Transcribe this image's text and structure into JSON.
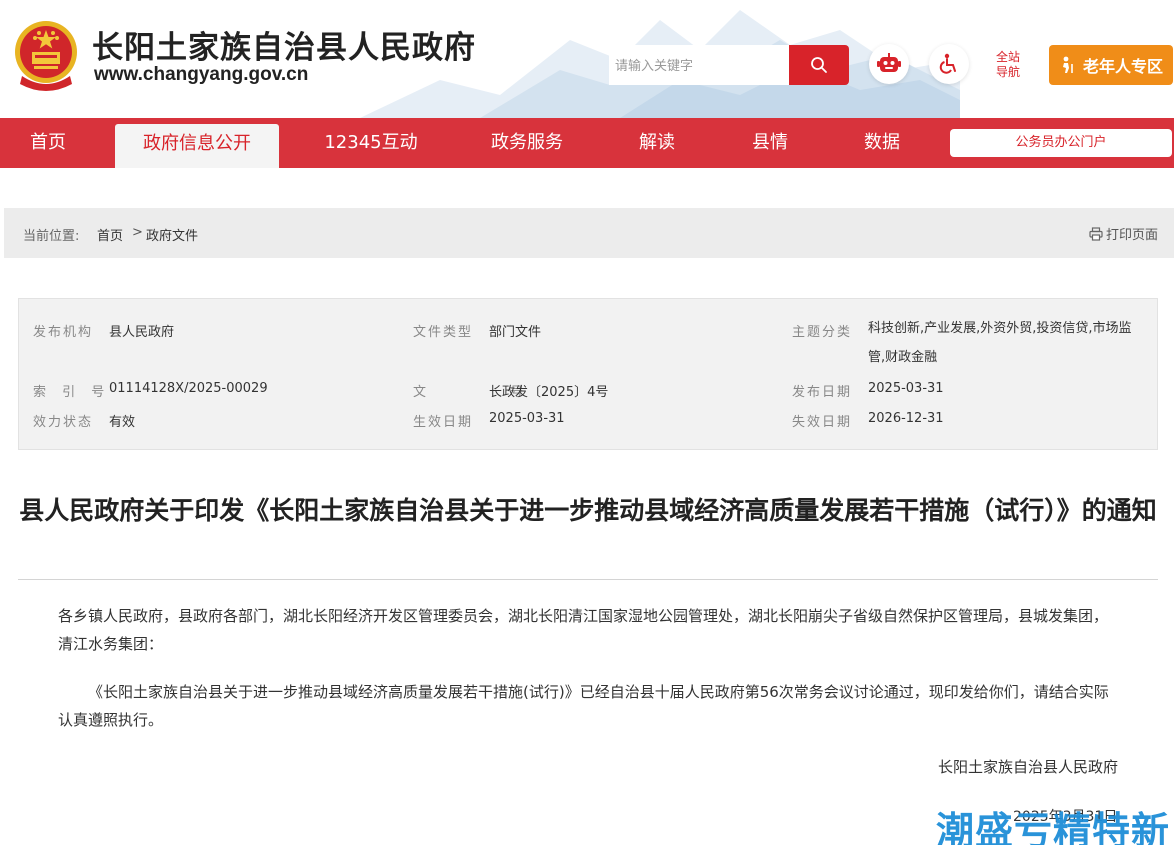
{
  "header": {
    "site_title": "长阳土家族自治县人民政府",
    "site_url": "www.changyang.gov.cn",
    "search_placeholder": "请输入关键字",
    "sitemap_line1": "全站",
    "sitemap_line2": "导航",
    "elder_label": "老年人专区",
    "colors": {
      "brand_red": "#d8232a",
      "elder_orange": "#f08d18"
    },
    "icons": [
      "national-emblem-icon",
      "search-icon",
      "robot-icon",
      "accessibility-icon",
      "elder-icon"
    ]
  },
  "nav": {
    "items": [
      {
        "label": "首页"
      },
      {
        "label": "政府信息公开"
      },
      {
        "label": "12345互动"
      },
      {
        "label": "政务服务"
      },
      {
        "label": "解读"
      },
      {
        "label": "县情"
      },
      {
        "label": "数据"
      }
    ],
    "active_index": 1,
    "portal_label": "公务员办公门户"
  },
  "breadcrumb": {
    "label": "当前位置:",
    "home": "首页",
    "separator": ">",
    "current": "政府文件",
    "print_label": "打印页面"
  },
  "meta": {
    "publisher_key": "发布机构",
    "publisher": "县人民政府",
    "doc_type_key": "文件类型",
    "doc_type": "部门文件",
    "topic_key": "主题分类",
    "topic": "科技创新,产业发展,外资外贸,投资信贷,市场监管,财政金融",
    "index_key": "索 引 号",
    "index": "01114128X/2025-00029",
    "doc_no_key": "文 号",
    "doc_no": "长政发〔2025〕4号",
    "pub_date_key": "发布日期",
    "pub_date": "2025-03-31",
    "status_key": "效力状态",
    "status": "有效",
    "effective_key": "生效日期",
    "effective": "2025-03-31",
    "expire_key": "失效日期",
    "expire": "2026-12-31"
  },
  "article": {
    "title": "县人民政府关于印发《长阳土家族自治县关于进一步推动县域经济高质量发展若干措施（试行）》的通知",
    "recipients": "各乡镇人民政府，县政府各部门，湖北长阳经济开发区管理委员会，湖北长阳清江国家湿地公园管理处，湖北长阳崩尖子省级自然保护区管理局，县城发集团，清江水务集团：",
    "body": "《长阳土家族自治县关于进一步推动县域经济高质量发展若干措施(试行)》已经自治县十届人民政府第56次常务会议讨论通过，现印发给你们，请结合实际认真遵照执行。",
    "signature": "长阳土家族自治县人民政府",
    "date": "2025年3月31日"
  },
  "watermark": "潮盛亏精特新"
}
